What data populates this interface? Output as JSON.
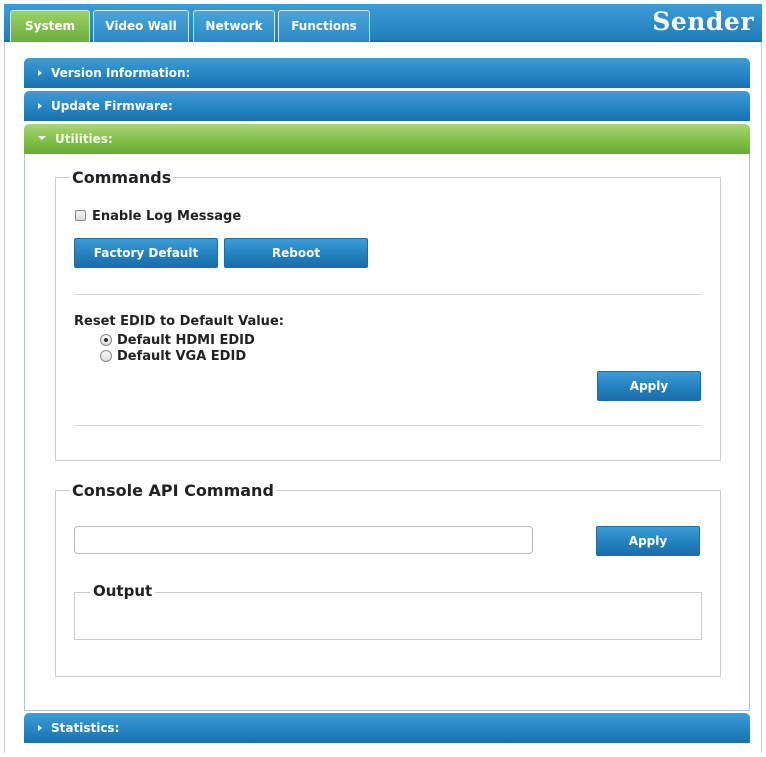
{
  "brand": "Sender",
  "tabs": [
    {
      "label": "System",
      "active": true
    },
    {
      "label": "Video Wall",
      "active": false
    },
    {
      "label": "Network",
      "active": false
    },
    {
      "label": "Functions",
      "active": false
    }
  ],
  "accordion": {
    "version": "Version Information:",
    "firmware": "Update Firmware:",
    "utilities": "Utilities:",
    "statistics": "Statistics:"
  },
  "commands": {
    "legend": "Commands",
    "enable_log": "Enable Log Message",
    "factory_default": "Factory Default",
    "reboot": "Reboot",
    "reset_edid_label": "Reset EDID to Default Value:",
    "edid_options": [
      "Default HDMI EDID",
      "Default VGA EDID"
    ],
    "edid_selected": "Default HDMI EDID",
    "apply": "Apply"
  },
  "console": {
    "legend": "Console API Command",
    "input_value": "",
    "apply": "Apply",
    "output_legend": "Output"
  },
  "colors": {
    "tab_active": "#7fbd47",
    "header_blue": "#2583c2",
    "header_green": "#7fbd47"
  }
}
